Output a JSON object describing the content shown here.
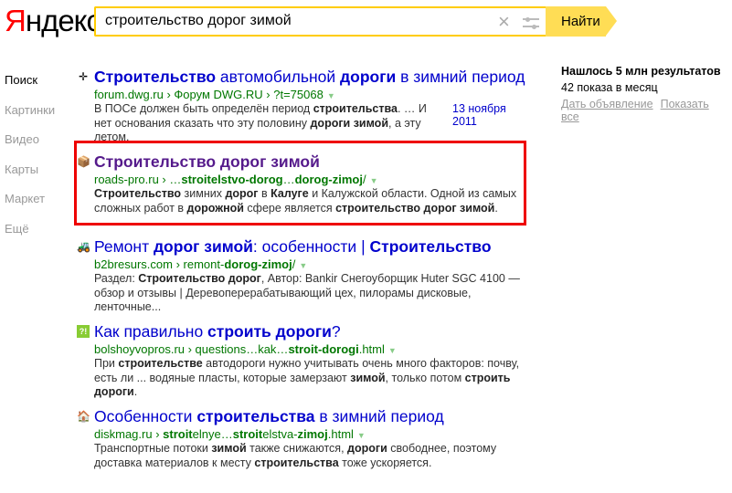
{
  "logo": {
    "first": "Я",
    "rest": "ндекс"
  },
  "search": {
    "value": "строительство дорог зимой",
    "button": "Найти"
  },
  "nav": [
    "Поиск",
    "Картинки",
    "Видео",
    "Карты",
    "Маркет",
    "Ещё"
  ],
  "stats": {
    "found": "Нашлось 5 млн результатов",
    "shows": "42 показа в месяц",
    "links": [
      "Дать объявление",
      "Показать все"
    ]
  },
  "highlight_color": "#e00000",
  "results": [
    {
      "icon": "crosshair-icon",
      "glyph": "✛",
      "visited": false,
      "title": [
        {
          "t": "Строительство",
          "b": true
        },
        {
          "t": " автомобильной ",
          "b": false
        },
        {
          "t": "дороги",
          "b": true
        },
        {
          "t": " в зимний период",
          "b": false
        }
      ],
      "url": [
        {
          "t": "forum.dwg.ru › Форум DWG.RU › ?t=75068",
          "b": false
        }
      ],
      "date": "13 ноября 2011",
      "snippet": [
        {
          "t": "В ПОСе должен быть определён период ",
          "b": false
        },
        {
          "t": "строительства",
          "b": true
        },
        {
          "t": ". … И нет основания сказать что эту половину ",
          "b": false
        },
        {
          "t": "дороги зимой",
          "b": true
        },
        {
          "t": ", а эту летом.",
          "b": false
        }
      ]
    },
    {
      "icon": "box-icon",
      "glyph": "📦",
      "visited": true,
      "title": [
        {
          "t": "Строительство дорог зимой",
          "b": true
        }
      ],
      "url": [
        {
          "t": "roads-pro.ru › …",
          "b": false
        },
        {
          "t": "stroitelstvo-dorog",
          "b": true
        },
        {
          "t": "…",
          "b": false
        },
        {
          "t": "dorog-zimoj",
          "b": true
        },
        {
          "t": "/",
          "b": false
        }
      ],
      "snippet": [
        {
          "t": "Строительство",
          "b": true
        },
        {
          "t": " зимних ",
          "b": false
        },
        {
          "t": "дорог",
          "b": true
        },
        {
          "t": " в ",
          "b": false
        },
        {
          "t": "Калуге",
          "b": true
        },
        {
          "t": " и Калужской области. Одной из самых сложных работ в ",
          "b": false
        },
        {
          "t": "дорожной",
          "b": true
        },
        {
          "t": " сфере является ",
          "b": false
        },
        {
          "t": "строительство дорог зимой",
          "b": true
        },
        {
          "t": ".",
          "b": false
        }
      ]
    },
    {
      "icon": "tractor-icon",
      "glyph": "🚜",
      "visited": false,
      "title": [
        {
          "t": "Ремонт ",
          "b": false
        },
        {
          "t": "дорог зимой",
          "b": true
        },
        {
          "t": ": особенности | ",
          "b": false
        },
        {
          "t": "Строительство",
          "b": true
        }
      ],
      "url": [
        {
          "t": "b2bresurs.com › remont-",
          "b": false
        },
        {
          "t": "dorog-zimoj",
          "b": true
        },
        {
          "t": "/",
          "b": false
        }
      ],
      "snippet": [
        {
          "t": "Раздел: ",
          "b": false
        },
        {
          "t": "Строительство дорог",
          "b": true
        },
        {
          "t": ", Автор: Bankir Снегоуборщик Huter SGC 4100 — обзор и отзывы | Деревоперерабатывающий цех, пилорамы дисковые, ленточные...",
          "b": false
        }
      ]
    },
    {
      "icon": "question-icon",
      "glyph": "?!",
      "visited": false,
      "title": [
        {
          "t": "Как правильно ",
          "b": false
        },
        {
          "t": "строить дороги",
          "b": true
        },
        {
          "t": "?",
          "b": false
        }
      ],
      "url": [
        {
          "t": "bolshoyvopros.ru › questions…kak…",
          "b": false
        },
        {
          "t": "stroit-dorogi",
          "b": true
        },
        {
          "t": ".html",
          "b": false
        }
      ],
      "snippet": [
        {
          "t": "При ",
          "b": false
        },
        {
          "t": "строительстве",
          "b": true
        },
        {
          "t": " автодороги нужно учитывать очень много факторов: почву, есть ли ... водяные пласты, которые замерзают ",
          "b": false
        },
        {
          "t": "зимой",
          "b": true
        },
        {
          "t": ", только потом ",
          "b": false
        },
        {
          "t": "строить дороги",
          "b": true
        },
        {
          "t": ".",
          "b": false
        }
      ]
    },
    {
      "icon": "house-icon",
      "glyph": "🏠",
      "visited": false,
      "title": [
        {
          "t": "Особенности ",
          "b": false
        },
        {
          "t": "строительства",
          "b": true
        },
        {
          "t": " в зимний период",
          "b": false
        }
      ],
      "url": [
        {
          "t": "diskmag.ru › ",
          "b": false
        },
        {
          "t": "stroit",
          "b": true
        },
        {
          "t": "elnye…",
          "b": false
        },
        {
          "t": "stroit",
          "b": true
        },
        {
          "t": "elstva-",
          "b": false
        },
        {
          "t": "zimoj",
          "b": true
        },
        {
          "t": ".html",
          "b": false
        }
      ],
      "snippet": [
        {
          "t": "Транспортные потоки ",
          "b": false
        },
        {
          "t": "зимой",
          "b": true
        },
        {
          "t": " также снижаются, ",
          "b": false
        },
        {
          "t": "дороги",
          "b": true
        },
        {
          "t": " свободнее, поэтому доставка материалов к месту ",
          "b": false
        },
        {
          "t": "строительства",
          "b": true
        },
        {
          "t": " тоже ускоряется.",
          "b": false
        }
      ]
    }
  ]
}
